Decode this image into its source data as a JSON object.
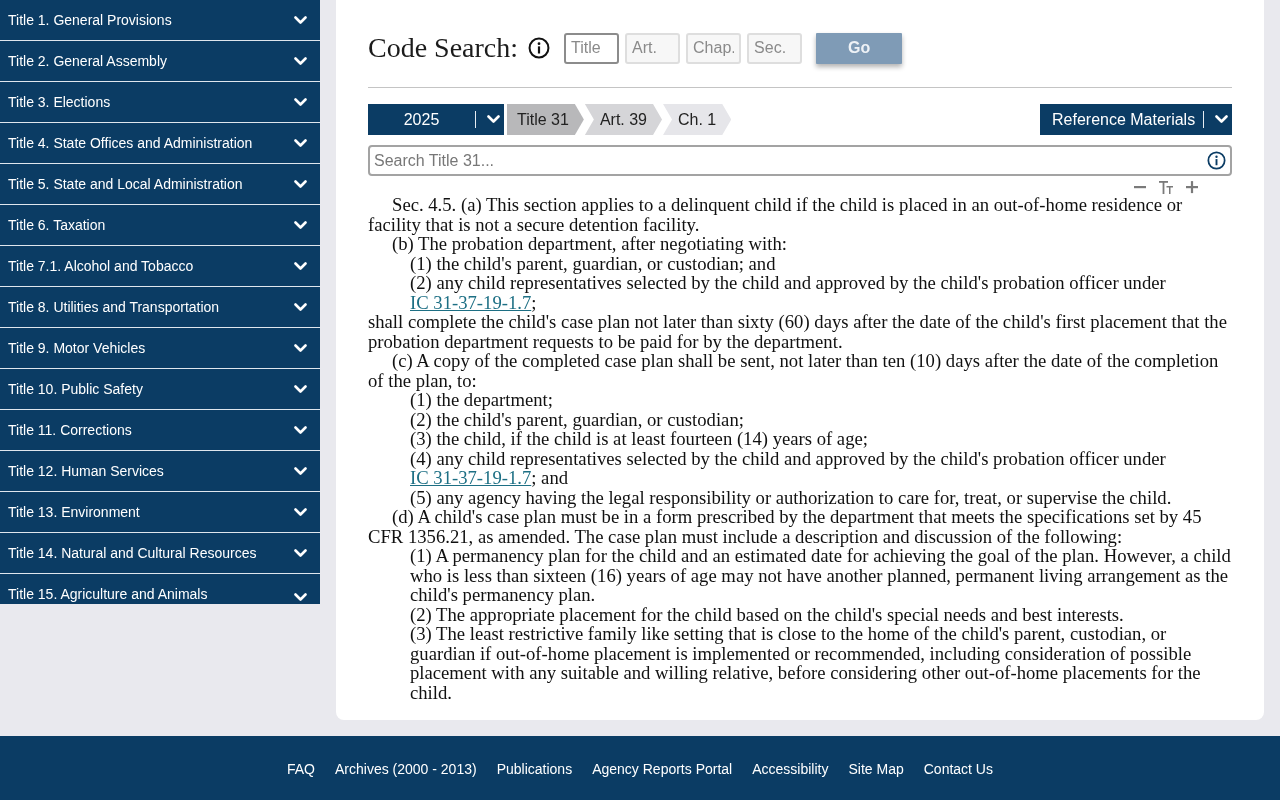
{
  "sidebar": {
    "items": [
      {
        "label": "Title 1. General Provisions",
        "expanded": false
      },
      {
        "label": "Title 2. General Assembly",
        "expanded": false
      },
      {
        "label": "Title 3. Elections",
        "expanded": false
      },
      {
        "label": "Title 4. State Offices and Administration",
        "expanded": false
      },
      {
        "label": "Title 5. State and Local Administration",
        "expanded": false
      },
      {
        "label": "Title 6. Taxation",
        "expanded": false
      },
      {
        "label": "Title 7.1. Alcohol and Tobacco",
        "expanded": false
      },
      {
        "label": "Title 8. Utilities and Transportation",
        "expanded": false
      },
      {
        "label": "Title 9. Motor Vehicles",
        "expanded": false
      },
      {
        "label": "Title 10. Public Safety",
        "expanded": false
      },
      {
        "label": "Title 11. Corrections",
        "expanded": false
      },
      {
        "label": "Title 12. Human Services",
        "expanded": false
      },
      {
        "label": "Title 13. Environment",
        "expanded": false
      },
      {
        "label": "Title 14. Natural and Cultural Resources",
        "expanded": false
      },
      {
        "label": "Title 15. Agriculture and Animals",
        "expanded": false
      }
    ]
  },
  "code_search": {
    "title": "Code Search:",
    "fields": [
      {
        "placeholder": "Title",
        "disabled": false
      },
      {
        "placeholder": "Art.",
        "disabled": true
      },
      {
        "placeholder": "Chap.",
        "disabled": true
      },
      {
        "placeholder": "Sec.",
        "disabled": true
      }
    ],
    "button": {
      "label": "Go",
      "disabled": true
    }
  },
  "breadcrumb": {
    "year": "2025",
    "crumbs": [
      "Title 31",
      "Art. 39",
      "Ch. 1"
    ],
    "reference_menu": "Reference Materials"
  },
  "search": {
    "placeholder": "Search Title 31..."
  },
  "document": {
    "paragraphs": [
      {
        "kind": "subsection",
        "text": "Sec. 4.5. (a) This section applies to a delinquent child if the child is placed in an out-of-home residence or facility that is not a secure detention facility."
      },
      {
        "kind": "subsection",
        "text": "(b) The probation department, after negotiating with:"
      },
      {
        "kind": "item",
        "text": "(1) the child's parent, guardian, or custodian; and"
      },
      {
        "kind": "item",
        "text": "(2) any child representatives selected by the child and approved by the child's probation officer under ",
        "link": "IC 31-37-19-1.7",
        "after": ";"
      },
      {
        "kind": "flush",
        "text": "shall complete the child's case plan not later than sixty (60) days after the date of the child's first placement that the probation department requests to be paid for by the department."
      },
      {
        "kind": "subsection",
        "text": "(c) A copy of the completed case plan shall be sent, not later than ten (10) days after the date of the completion of the plan, to:"
      },
      {
        "kind": "item",
        "text": "(1) the department;"
      },
      {
        "kind": "item",
        "text": "(2) the child's parent, guardian, or custodian;"
      },
      {
        "kind": "item",
        "text": "(3) the child, if the child is at least fourteen (14) years of age;"
      },
      {
        "kind": "item",
        "text": "(4) any child representatives selected by the child and approved by the child's probation officer under ",
        "link": "IC 31-37-19-1.7",
        "after": "; and"
      },
      {
        "kind": "item",
        "text": "(5) any agency having the legal responsibility or authorization to care for, treat, or supervise the child."
      },
      {
        "kind": "subsection",
        "text": "(d) A child's case plan must be in a form prescribed by the department that meets the specifications set by 45 CFR 1356.21, as amended. The case plan must include a description and discussion of the following:"
      },
      {
        "kind": "item",
        "text": "(1) A permanency plan for the child and an estimated date for achieving the goal of the plan. However, a child who is less than sixteen (16) years of age may not have another planned, permanent living arrangement as the child's permanency plan."
      },
      {
        "kind": "item",
        "text": "(2) The appropriate placement for the child based on the child's special needs and best interests."
      },
      {
        "kind": "item",
        "text": "(3) The least restrictive family like setting that is close to the home of the child's parent, custodian, or guardian if out-of-home placement is implemented or recommended, including consideration of possible placement with any suitable and willing relative, before considering other out-of-home placements for the child."
      }
    ]
  },
  "footer": {
    "links": [
      "FAQ",
      "Archives (2000 - 2013)",
      "Publications",
      "Agency Reports Portal",
      "Accessibility",
      "Site Map",
      "Contact Us"
    ]
  }
}
